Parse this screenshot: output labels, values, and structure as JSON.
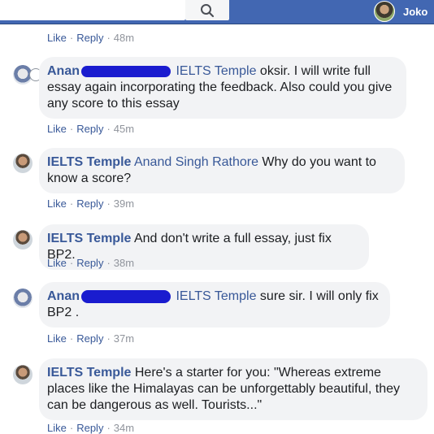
{
  "topbar": {
    "profile_name": "Joko",
    "search_icon": "search-icon"
  },
  "labels": {
    "like": "Like",
    "reply": "Reply",
    "dot": "·"
  },
  "first_actions_time": "48m",
  "comments": [
    {
      "author": "Anan",
      "tag": "IELTS Temple",
      "text": " oksir. I will write full essay again incorporating the feedback. Also could you give any score to this essay",
      "time": "45m"
    },
    {
      "author": "IELTS Temple",
      "tag": "Anand Singh Rathore",
      "text": " Why do you want to know a score?",
      "time": "39m"
    },
    {
      "author": "IELTS Temple",
      "tag": "",
      "text": " And don't write a full essay, just fix BP2.",
      "time": "38m"
    },
    {
      "author": "Anan",
      "tag": "IELTS Temple",
      "text": " sure sir. I will only fix BP2 .",
      "time": "37m"
    },
    {
      "author": "IELTS Temple",
      "tag": "",
      "text": " Here's a starter for you: \"Whereas extreme places like the Himalayas can be unforgettably beautiful, they can be dangerous as well. Tourists...\"",
      "time": "34m"
    }
  ]
}
